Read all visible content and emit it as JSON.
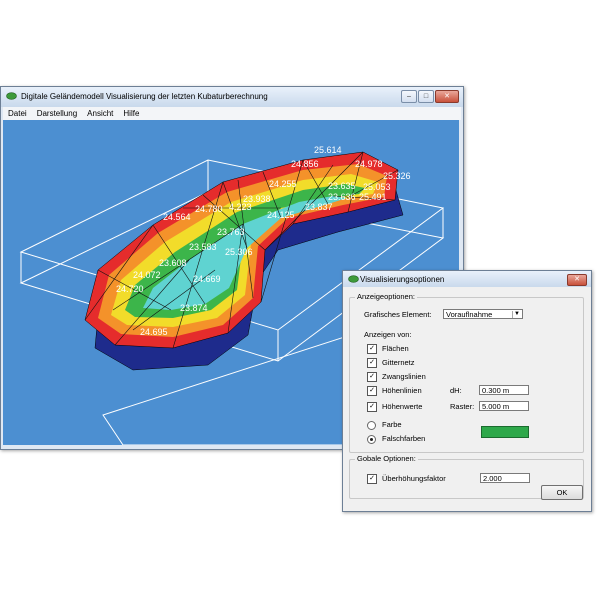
{
  "main_window": {
    "title": "Digitale Geländemodell Visualisierung der letzten Kubaturberechnung",
    "menu": [
      "Datei",
      "Darstellung",
      "Ansicht",
      "Hilfe"
    ]
  },
  "terrain": {
    "height_labels": [
      "25.614",
      "24.856",
      "24.978",
      "24.255",
      "23.635",
      "25.326",
      "25.053",
      "23.636",
      "25.491",
      "23.938",
      "24.780",
      "4.223",
      "23.837",
      "24.564",
      "24.125",
      "23.763",
      "23.583",
      "25.306",
      "23.608",
      "24.072",
      "24.669",
      "24.720",
      "23.874",
      "24.695"
    ],
    "colors": {
      "background": "#4c8fd1",
      "base": "#1e2b8c",
      "outer": "#e52c2c",
      "mid": "#f2dc2a",
      "inner": "#3cb54a"
    }
  },
  "dialog": {
    "title": "Visualisierungsoptionen",
    "anzeige_group": "Anzeigeoptionen:",
    "grafisches_label": "Grafisches Element:",
    "grafisches_value": "Vorauflnahme",
    "anzeigen_von": "Anzeigen von:",
    "checkboxes": [
      {
        "label": "Flächen",
        "checked": true
      },
      {
        "label": "Gitternetz",
        "checked": true
      },
      {
        "label": "Zwangslinien",
        "checked": true
      },
      {
        "label": "Höhenlinien",
        "checked": true
      },
      {
        "label": "Höhenwerte",
        "checked": true
      }
    ],
    "dh_label": "dH:",
    "dh_value": "0.300 m",
    "raster_label": "Raster:",
    "raster_value": "5.000 m",
    "radio_farbe": "Farbe",
    "radio_falsch": "Falschfarben",
    "swatch_color": "#2ea84a",
    "global_group": "Gobale Optionen:",
    "ueberhoehung_label": "Überhöhungsfaktor",
    "ueberhoehung_value": "2.000",
    "ok_label": "OK"
  }
}
